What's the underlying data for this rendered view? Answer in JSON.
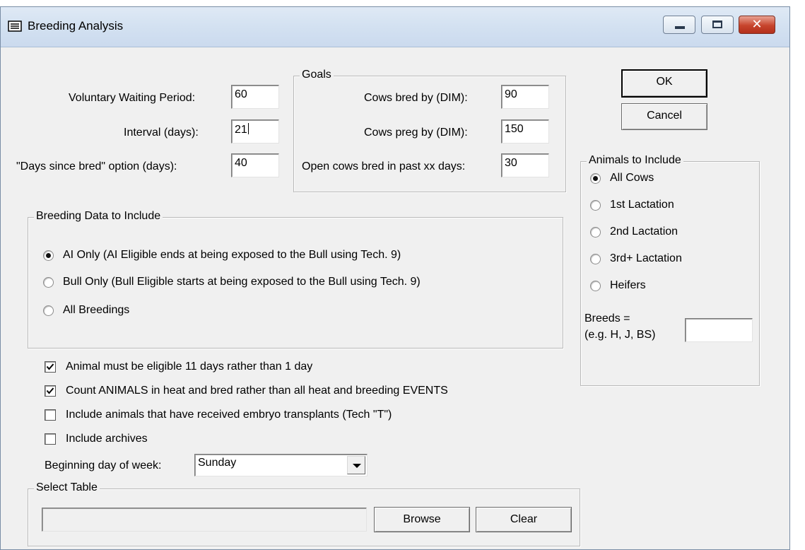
{
  "window": {
    "title": "Breeding Analysis",
    "minimize_glyph": "",
    "close_glyph": "✕"
  },
  "periods": {
    "vwp_label": "Voluntary Waiting Period:",
    "vwp_value": "60",
    "interval_label": "Interval (days):",
    "interval_value": "21",
    "days_since_label": "\"Days since bred\" option (days):",
    "days_since_value": "40"
  },
  "goals": {
    "legend": "Goals",
    "bred_label": "Cows bred by (DIM):",
    "bred_value": "90",
    "preg_label": "Cows preg by (DIM):",
    "preg_value": "150",
    "open_label": "Open cows bred in past xx days:",
    "open_value": "30"
  },
  "buttons": {
    "ok": "OK",
    "cancel": "Cancel",
    "browse": "Browse",
    "clear": "Clear"
  },
  "animals": {
    "legend": "Animals to Include",
    "options": [
      "All Cows",
      "1st Lactation",
      "2nd Lactation",
      "3rd+ Lactation",
      "Heifers"
    ],
    "selected": "All Cows",
    "breeds_label_1": "Breeds =",
    "breeds_label_2": "(e.g. H, J, BS)",
    "breeds_value": ""
  },
  "breeding_data": {
    "legend": "Breeding Data to Include",
    "options": [
      "AI Only (AI Eligible ends at being exposed to the Bull using Tech. 9)",
      "Bull Only (Bull Eligible starts at being exposed to the Bull using Tech. 9)",
      "All Breedings"
    ],
    "selected": "AI Only (AI Eligible ends at being exposed to the Bull using Tech. 9)"
  },
  "checkboxes": [
    {
      "label": "Animal must be eligible 11 days rather than 1 day",
      "checked": true
    },
    {
      "label": "Count ANIMALS in heat and bred rather than all heat and breeding EVENTS",
      "checked": true
    },
    {
      "label": "Include animals that have received embryo transplants (Tech \"T\")",
      "checked": false
    },
    {
      "label": "Include archives",
      "checked": false
    }
  ],
  "week": {
    "label": "Beginning day of week:",
    "value": "Sunday"
  },
  "select_table": {
    "legend": "Select Table",
    "path_value": ""
  }
}
